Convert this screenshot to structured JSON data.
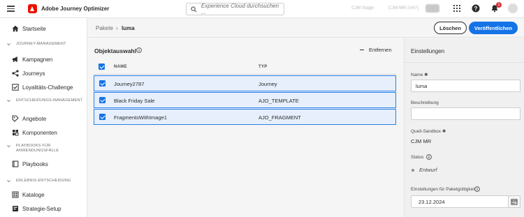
{
  "app": {
    "title": "Adobe Journey Optimizer",
    "search_placeholder": "Experience Cloud durchsuchen ...",
    "sandbox_stage": "CJM Stage",
    "sandbox_current": "CJM MR (VA7)",
    "notification_count": "1",
    "accent_color": "#1473e6",
    "brand_color": "#eb1000"
  },
  "sidebar": {
    "home": "Startseite",
    "sections": [
      {
        "label": "JOURNEY-MANAGEMENT",
        "items": [
          "Kampagnen",
          "Journeys",
          "Loyalitäts-Challenge"
        ]
      },
      {
        "label": "ENTSCHEIDUNGS-MANAGEMENT",
        "items": [
          "Angebote",
          "Komponenten"
        ]
      },
      {
        "label": "PLAYBOOKS FÜR ANWENDUNGSFÄLLE",
        "items": [
          "Playbooks"
        ]
      },
      {
        "label": "ERLEBNIS-ENTSCHEIDUNG",
        "items": [
          "Kataloge",
          "Strategie-Setup"
        ]
      }
    ]
  },
  "header": {
    "breadcrumb_parent": "Pakete",
    "breadcrumb_sep": "›",
    "breadcrumb_current": "luma",
    "delete_label": "Löschen",
    "publish_label": "Veröffentlichen"
  },
  "main": {
    "title": "Objektauswahl",
    "remove_label": "Entfernen",
    "columns": [
      "NAME",
      "TYP"
    ],
    "rows": [
      {
        "name": "Journey2787",
        "type": "Journey"
      },
      {
        "name": "Black Friday Sale",
        "type": "AJO_TEMPLATE"
      },
      {
        "name": "FragmentsWithImage1",
        "type": "AJO_FRAGMENT"
      }
    ]
  },
  "settings": {
    "title": "Einstellungen",
    "name_label": "Name",
    "name_value": "luma",
    "description_label": "Beschreibung",
    "description_value": "",
    "source_sandbox_label": "Quell-Sandbox",
    "source_sandbox_value": "CJM MR",
    "status_label": "Status",
    "status_value": "Entwurf",
    "validity_label": "Einstellungen für Paketgültigkeit",
    "validity_value": "23.12.2024",
    "required_mark": "✱"
  }
}
